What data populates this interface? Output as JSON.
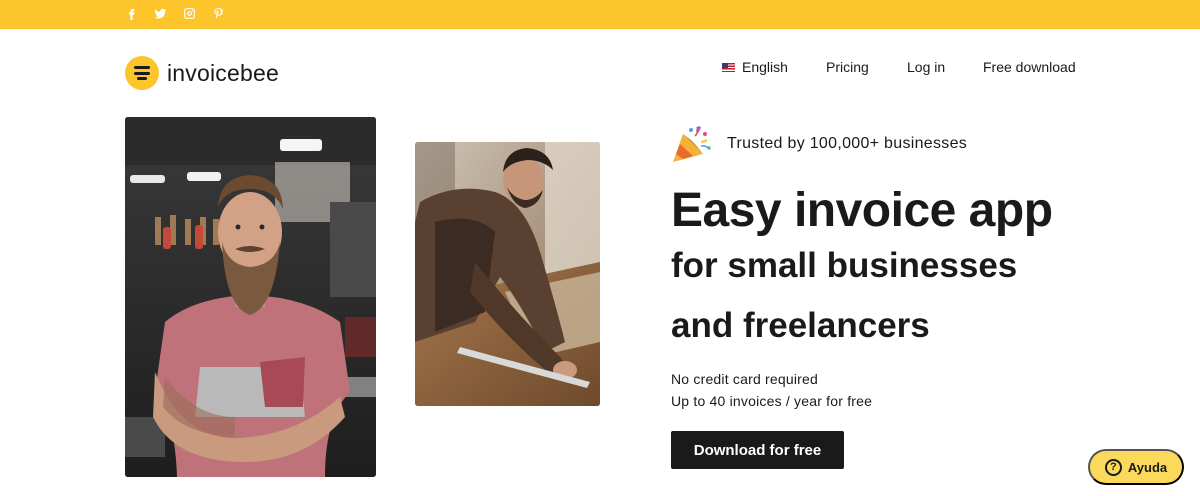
{
  "topbar": {
    "social": [
      "facebook-icon",
      "twitter-icon",
      "instagram-icon",
      "pinterest-icon"
    ],
    "color": "#fbc52b"
  },
  "brand": {
    "name": "invoicebee"
  },
  "nav": {
    "language": "English",
    "pricing": "Pricing",
    "login": "Log in",
    "download": "Free download"
  },
  "hero": {
    "trusted": "Trusted by 100,000+ businesses",
    "title": "Easy invoice app",
    "subtitle_line1": "for small businesses",
    "subtitle_line2": "and freelancers",
    "note1": "No credit card required",
    "note2": "Up to 40 invoices / year for free",
    "cta": "Download for free"
  },
  "help": {
    "label": "Ayuda",
    "icon": "?"
  }
}
